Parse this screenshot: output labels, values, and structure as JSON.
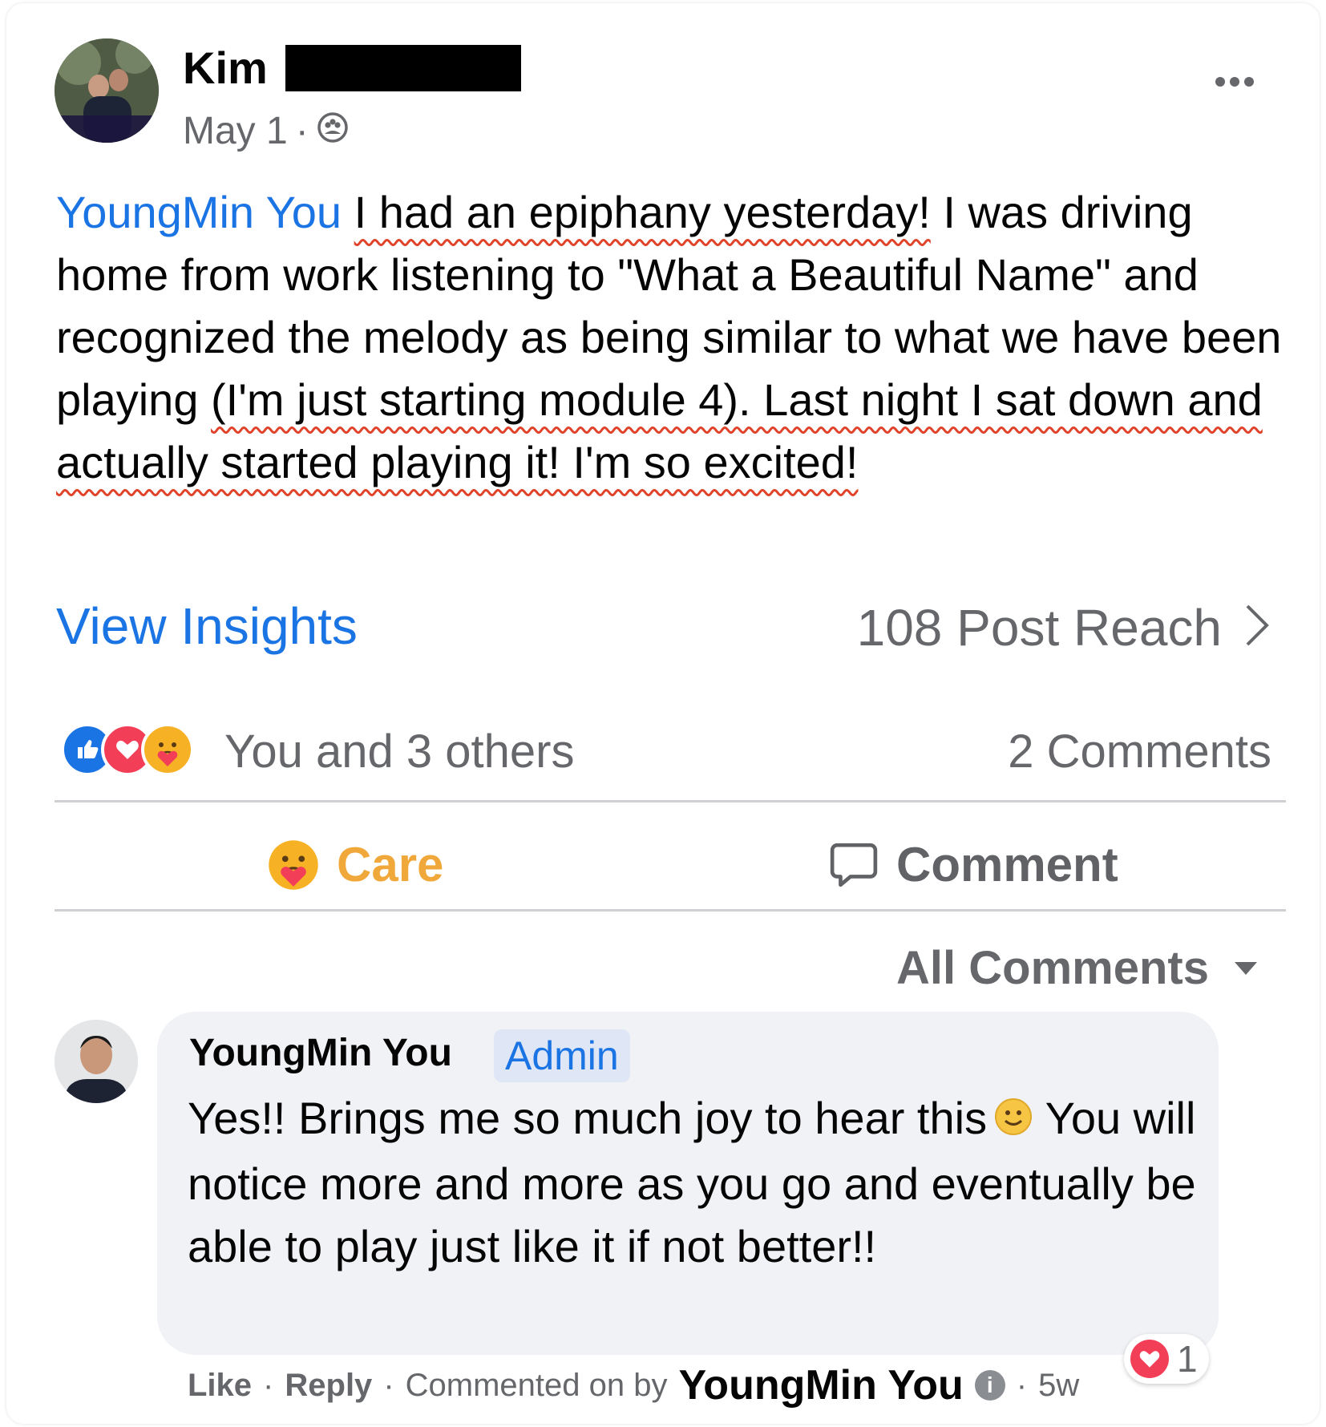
{
  "post": {
    "author_first": "Kim",
    "date": "May 1",
    "dot": "·",
    "mention": "YoungMin You",
    "text_segments": [
      {
        "t": " ",
        "u": false
      },
      {
        "t": "I had an epiphany yesterday!",
        "u": true
      },
      {
        "t": " I was driving home from work listening to \"What a Beautiful Name\" and recognized the melody as being similar to what we have been playing ",
        "u": false
      },
      {
        "t": "(I'm just starting module 4). Last night I sat down and actually started playing it! I'm so excited!",
        "u": true
      }
    ]
  },
  "insights": {
    "view_label": "View Insights",
    "reach_label": "108 Post Reach"
  },
  "reactions": {
    "summary": "You and 3 others",
    "comments_count": "2 Comments"
  },
  "actions": {
    "care_label": "Care",
    "comment_label": "Comment"
  },
  "comments_filter": {
    "label": "All Comments"
  },
  "comment": {
    "author": "YoungMin You",
    "badge": "Admin",
    "text": "Yes!! Brings me so much joy to hear this",
    "text_cont": "You will notice more and more as you go and eventually be able to play just like it if not better!!",
    "love_count": "1",
    "footer": {
      "like": "Like",
      "reply": "Reply",
      "commented_on_by": "Commented on by",
      "by_name": "YoungMin You",
      "age": "5w",
      "sep": "·"
    }
  },
  "colors": {
    "link_blue": "#1b74e4",
    "care_yellow": "#f0a83b",
    "love_red": "#f33e58",
    "underline_red": "#e0432a"
  }
}
